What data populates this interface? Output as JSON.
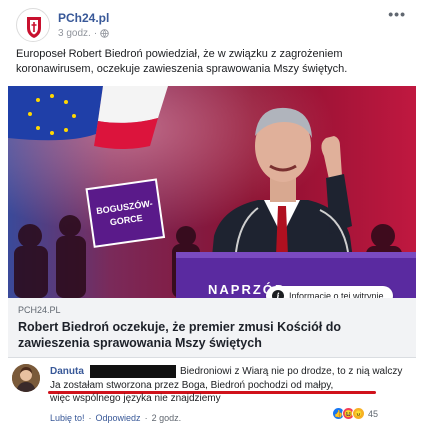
{
  "post": {
    "page_name": "PCh24.pl",
    "time": "3 godz.",
    "text": "Europoseł Robert Biedroń powiedział, że w związku z zagrożeniem koronawirusem, oczekuje zawieszenia sprawowania Mszy świętych."
  },
  "image": {
    "podium_text": "NAPRZÓD",
    "sign_text_1": "BOGUSZÓW-",
    "sign_text_2": "GORCE"
  },
  "link": {
    "domain": "PCH24.PL",
    "title": "Robert Biedroń oczekuje, że premier zmusi Kościół do zawieszenia sprawowania Mszy świętych",
    "info_label": "Informacje o tej witrynie"
  },
  "comment": {
    "author": "Danuta",
    "line1": "Biedroniowi z Wiarą nie po drodze, to z nią walczy",
    "line2": "Ja zostałam stworzona przez Boga, Biedroń pochodzi od małpy,",
    "line3": "więc wspólnego języka nie znajdziemy",
    "like_label": "Lubię to!",
    "reply_label": "Odpowiedz",
    "time": "2 godz.",
    "reaction_count": "45",
    "underline_color": "#d0121b"
  },
  "icons": {
    "more": "more-icon",
    "globe": "globe-icon",
    "info": "info-icon"
  }
}
